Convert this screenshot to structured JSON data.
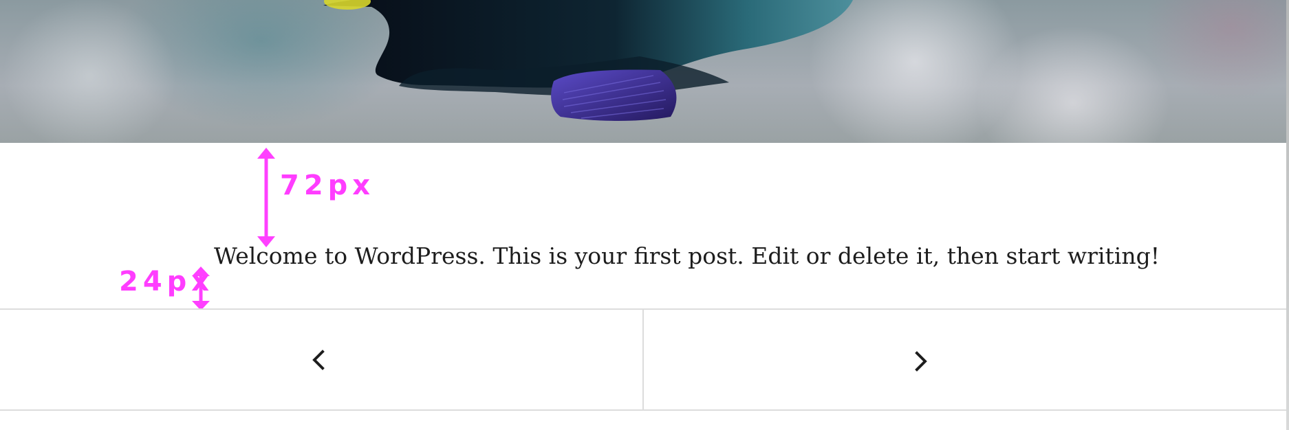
{
  "post": {
    "excerpt": "Welcome to WordPress. This is your first post. Edit or delete it, then start writing!"
  },
  "navigation": {
    "prev_icon": "chevron-left-icon",
    "next_icon": "chevron-right-icon"
  },
  "annotations": {
    "top_spacing_label": "72px",
    "bottom_spacing_label": "24px",
    "color": "#ff40ff"
  },
  "hero_image": {
    "subject": "tropical-fish-photo"
  }
}
